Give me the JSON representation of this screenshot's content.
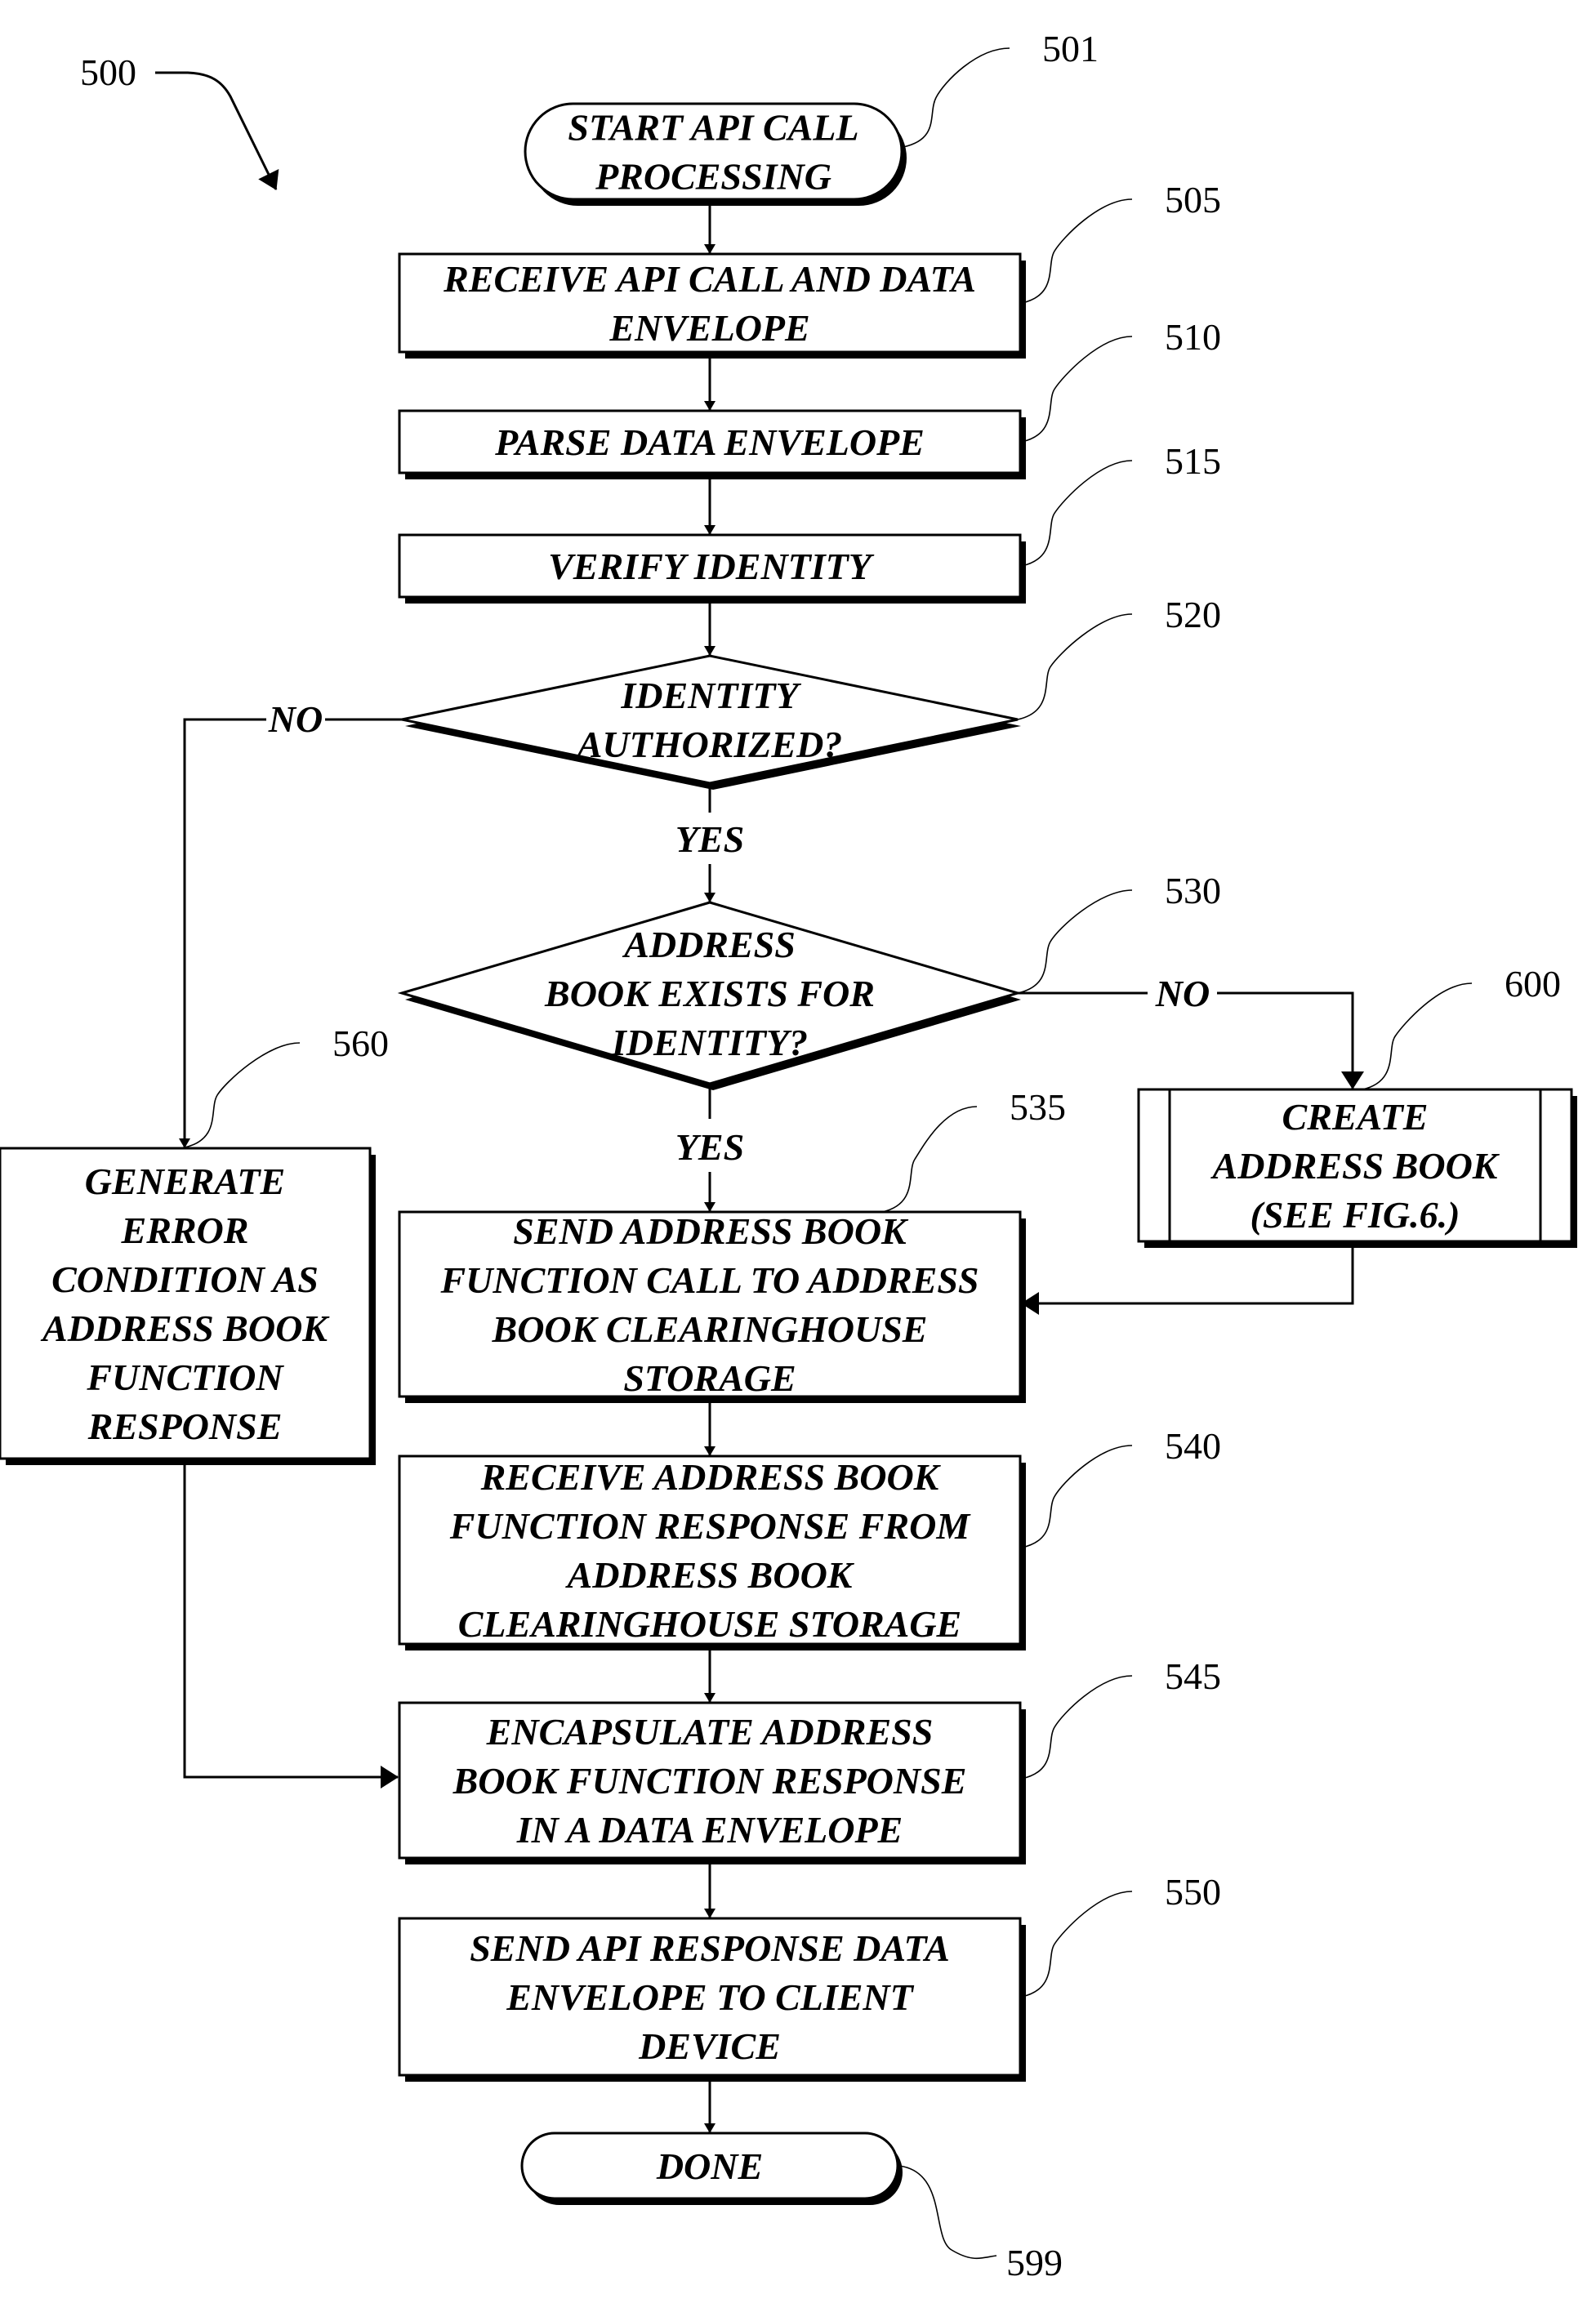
{
  "figure": {
    "ref": "500",
    "nodes": [
      {
        "id": "501",
        "type": "terminal",
        "lines": [
          "START API CALL",
          "PROCESSING"
        ]
      },
      {
        "id": "505",
        "type": "process",
        "lines": [
          "RECEIVE API CALL AND DATA",
          "ENVELOPE"
        ]
      },
      {
        "id": "510",
        "type": "process",
        "lines": [
          "PARSE DATA ENVELOPE"
        ]
      },
      {
        "id": "515",
        "type": "process",
        "lines": [
          "VERIFY IDENTITY"
        ]
      },
      {
        "id": "520",
        "type": "decision",
        "lines": [
          "IDENTITY",
          "AUTHORIZED?"
        ]
      },
      {
        "id": "530",
        "type": "decision",
        "lines": [
          "ADDRESS",
          "BOOK EXISTS FOR",
          "IDENTITY?"
        ]
      },
      {
        "id": "600",
        "type": "predefined-process",
        "lines": [
          "CREATE",
          "ADDRESS BOOK",
          "(SEE FIG.6.)"
        ]
      },
      {
        "id": "535",
        "type": "process",
        "lines": [
          "SEND ADDRESS BOOK",
          "FUNCTION CALL TO ADDRESS",
          "BOOK CLEARINGHOUSE",
          "STORAGE"
        ]
      },
      {
        "id": "560",
        "type": "process",
        "lines": [
          "GENERATE",
          "ERROR",
          "CONDITION AS",
          "ADDRESS BOOK",
          "FUNCTION",
          "RESPONSE"
        ]
      },
      {
        "id": "540",
        "type": "process",
        "lines": [
          "RECEIVE ADDRESS BOOK",
          "FUNCTION RESPONSE FROM",
          "ADDRESS BOOK",
          "CLEARINGHOUSE STORAGE"
        ]
      },
      {
        "id": "545",
        "type": "process",
        "lines": [
          "ENCAPSULATE ADDRESS",
          "BOOK FUNCTION RESPONSE",
          "IN A DATA ENVELOPE"
        ]
      },
      {
        "id": "550",
        "type": "process",
        "lines": [
          "SEND API RESPONSE DATA",
          "ENVELOPE TO CLIENT",
          "DEVICE"
        ]
      },
      {
        "id": "599",
        "type": "terminal",
        "lines": [
          "DONE"
        ]
      }
    ],
    "edges": [
      {
        "from": "501",
        "to": "505",
        "label": ""
      },
      {
        "from": "505",
        "to": "510",
        "label": ""
      },
      {
        "from": "510",
        "to": "515",
        "label": ""
      },
      {
        "from": "515",
        "to": "520",
        "label": ""
      },
      {
        "from": "520",
        "to": "530",
        "label": "YES"
      },
      {
        "from": "520",
        "to": "560",
        "label": "NO"
      },
      {
        "from": "530",
        "to": "535",
        "label": "YES"
      },
      {
        "from": "530",
        "to": "600",
        "label": "NO"
      },
      {
        "from": "600",
        "to": "535",
        "label": ""
      },
      {
        "from": "535",
        "to": "540",
        "label": ""
      },
      {
        "from": "540",
        "to": "545",
        "label": ""
      },
      {
        "from": "560",
        "to": "545",
        "label": ""
      },
      {
        "from": "545",
        "to": "550",
        "label": ""
      },
      {
        "from": "550",
        "to": "599",
        "label": ""
      }
    ]
  }
}
